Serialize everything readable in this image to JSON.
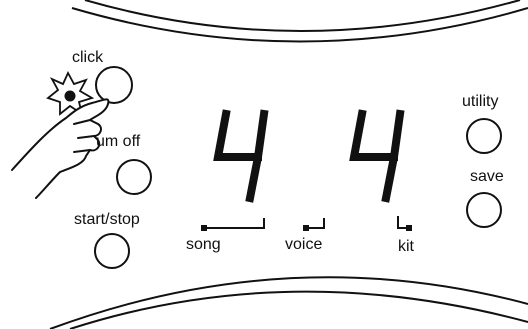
{
  "display": {
    "left_digit": "4",
    "right_digit": "4"
  },
  "labels": {
    "click": "click",
    "drum_off": "um off",
    "start_stop": "start/stop",
    "song": "song",
    "voice": "voice",
    "kit": "kit",
    "utility": "utility",
    "save": "save"
  },
  "icons": [
    "click-burst-icon",
    "pointing-hand-icon"
  ]
}
